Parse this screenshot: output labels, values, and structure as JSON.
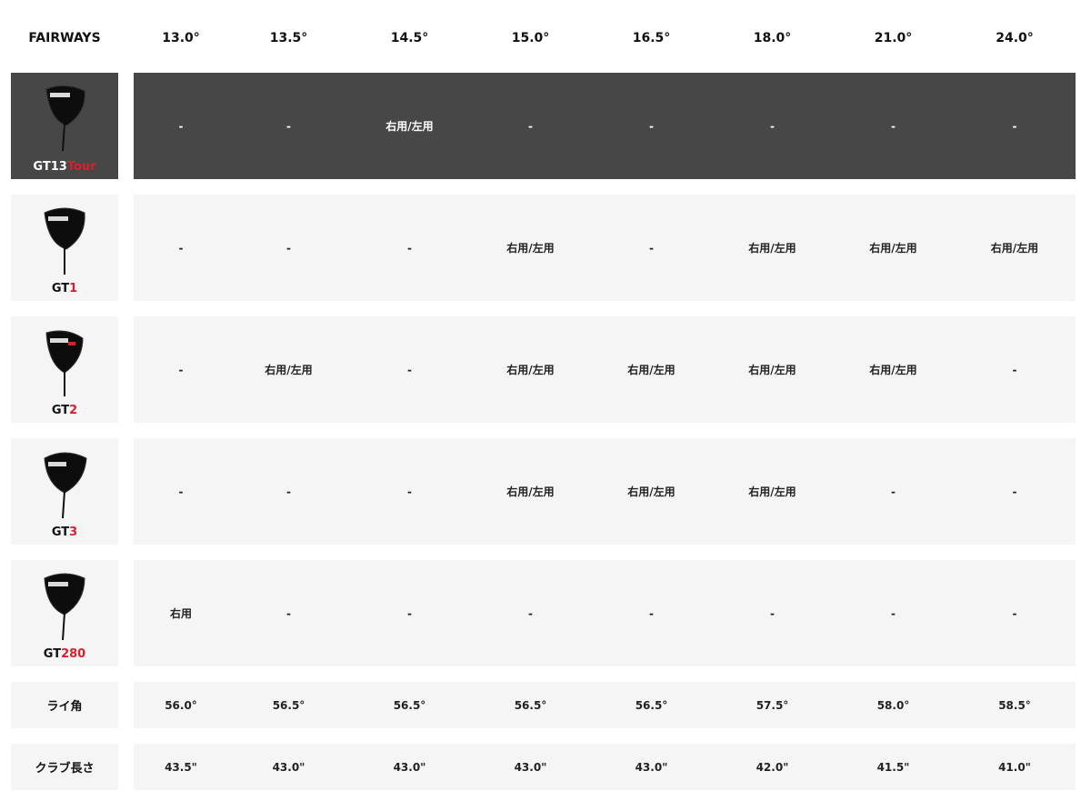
{
  "header": {
    "label": "FAIRWAYS",
    "lofts": [
      "13.0°",
      "13.5°",
      "14.5°",
      "15.0°",
      "16.5°",
      "18.0°",
      "21.0°",
      "24.0°"
    ]
  },
  "rows": [
    {
      "model_base": "GT13",
      "model_suffix": "Tour",
      "values": [
        "-",
        "-",
        "右用/左用",
        "-",
        "-",
        "-",
        "-",
        "-"
      ]
    },
    {
      "model_base": "GT",
      "model_suffix": "1",
      "values": [
        "-",
        "-",
        "-",
        "右用/左用",
        "-",
        "右用/左用",
        "右用/左用",
        "右用/左用"
      ]
    },
    {
      "model_base": "GT",
      "model_suffix": "2",
      "values": [
        "-",
        "右用/左用",
        "-",
        "右用/左用",
        "右用/左用",
        "右用/左用",
        "右用/左用",
        "-"
      ]
    },
    {
      "model_base": "GT",
      "model_suffix": "3",
      "values": [
        "-",
        "-",
        "-",
        "右用/左用",
        "右用/左用",
        "右用/左用",
        "-",
        "-"
      ]
    },
    {
      "model_base": "GT",
      "model_suffix": "280",
      "values": [
        "右用",
        "-",
        "-",
        "-",
        "-",
        "-",
        "-",
        "-"
      ]
    }
  ],
  "lie_angle": {
    "label": "ライ角",
    "values": [
      "56.0°",
      "56.5°",
      "56.5°",
      "56.5°",
      "56.5°",
      "57.5°",
      "58.0°",
      "58.5°"
    ]
  },
  "club_length": {
    "label": "クラブ長さ",
    "values": [
      "43.5\"",
      "43.0\"",
      "43.0\"",
      "43.0\"",
      "43.0\"",
      "42.0\"",
      "41.5\"",
      "41.0\""
    ]
  },
  "colors": {
    "accent": "#d6202f",
    "dark_row": "#474747",
    "light_row": "#f5f5f5"
  }
}
